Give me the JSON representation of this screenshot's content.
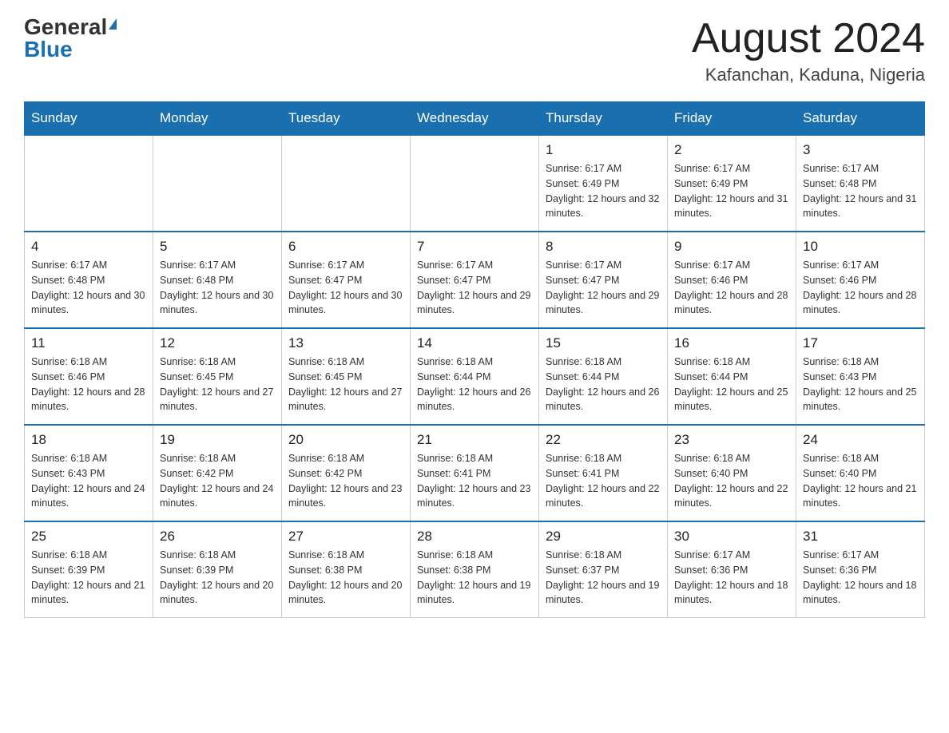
{
  "header": {
    "logo_general": "General",
    "logo_blue": "Blue",
    "month_title": "August 2024",
    "location": "Kafanchan, Kaduna, Nigeria"
  },
  "weekdays": [
    "Sunday",
    "Monday",
    "Tuesday",
    "Wednesday",
    "Thursday",
    "Friday",
    "Saturday"
  ],
  "weeks": [
    [
      {
        "day": "",
        "sunrise": "",
        "sunset": "",
        "daylight": ""
      },
      {
        "day": "",
        "sunrise": "",
        "sunset": "",
        "daylight": ""
      },
      {
        "day": "",
        "sunrise": "",
        "sunset": "",
        "daylight": ""
      },
      {
        "day": "",
        "sunrise": "",
        "sunset": "",
        "daylight": ""
      },
      {
        "day": "1",
        "sunrise": "Sunrise: 6:17 AM",
        "sunset": "Sunset: 6:49 PM",
        "daylight": "Daylight: 12 hours and 32 minutes."
      },
      {
        "day": "2",
        "sunrise": "Sunrise: 6:17 AM",
        "sunset": "Sunset: 6:49 PM",
        "daylight": "Daylight: 12 hours and 31 minutes."
      },
      {
        "day": "3",
        "sunrise": "Sunrise: 6:17 AM",
        "sunset": "Sunset: 6:48 PM",
        "daylight": "Daylight: 12 hours and 31 minutes."
      }
    ],
    [
      {
        "day": "4",
        "sunrise": "Sunrise: 6:17 AM",
        "sunset": "Sunset: 6:48 PM",
        "daylight": "Daylight: 12 hours and 30 minutes."
      },
      {
        "day": "5",
        "sunrise": "Sunrise: 6:17 AM",
        "sunset": "Sunset: 6:48 PM",
        "daylight": "Daylight: 12 hours and 30 minutes."
      },
      {
        "day": "6",
        "sunrise": "Sunrise: 6:17 AM",
        "sunset": "Sunset: 6:47 PM",
        "daylight": "Daylight: 12 hours and 30 minutes."
      },
      {
        "day": "7",
        "sunrise": "Sunrise: 6:17 AM",
        "sunset": "Sunset: 6:47 PM",
        "daylight": "Daylight: 12 hours and 29 minutes."
      },
      {
        "day": "8",
        "sunrise": "Sunrise: 6:17 AM",
        "sunset": "Sunset: 6:47 PM",
        "daylight": "Daylight: 12 hours and 29 minutes."
      },
      {
        "day": "9",
        "sunrise": "Sunrise: 6:17 AM",
        "sunset": "Sunset: 6:46 PM",
        "daylight": "Daylight: 12 hours and 28 minutes."
      },
      {
        "day": "10",
        "sunrise": "Sunrise: 6:17 AM",
        "sunset": "Sunset: 6:46 PM",
        "daylight": "Daylight: 12 hours and 28 minutes."
      }
    ],
    [
      {
        "day": "11",
        "sunrise": "Sunrise: 6:18 AM",
        "sunset": "Sunset: 6:46 PM",
        "daylight": "Daylight: 12 hours and 28 minutes."
      },
      {
        "day": "12",
        "sunrise": "Sunrise: 6:18 AM",
        "sunset": "Sunset: 6:45 PM",
        "daylight": "Daylight: 12 hours and 27 minutes."
      },
      {
        "day": "13",
        "sunrise": "Sunrise: 6:18 AM",
        "sunset": "Sunset: 6:45 PM",
        "daylight": "Daylight: 12 hours and 27 minutes."
      },
      {
        "day": "14",
        "sunrise": "Sunrise: 6:18 AM",
        "sunset": "Sunset: 6:44 PM",
        "daylight": "Daylight: 12 hours and 26 minutes."
      },
      {
        "day": "15",
        "sunrise": "Sunrise: 6:18 AM",
        "sunset": "Sunset: 6:44 PM",
        "daylight": "Daylight: 12 hours and 26 minutes."
      },
      {
        "day": "16",
        "sunrise": "Sunrise: 6:18 AM",
        "sunset": "Sunset: 6:44 PM",
        "daylight": "Daylight: 12 hours and 25 minutes."
      },
      {
        "day": "17",
        "sunrise": "Sunrise: 6:18 AM",
        "sunset": "Sunset: 6:43 PM",
        "daylight": "Daylight: 12 hours and 25 minutes."
      }
    ],
    [
      {
        "day": "18",
        "sunrise": "Sunrise: 6:18 AM",
        "sunset": "Sunset: 6:43 PM",
        "daylight": "Daylight: 12 hours and 24 minutes."
      },
      {
        "day": "19",
        "sunrise": "Sunrise: 6:18 AM",
        "sunset": "Sunset: 6:42 PM",
        "daylight": "Daylight: 12 hours and 24 minutes."
      },
      {
        "day": "20",
        "sunrise": "Sunrise: 6:18 AM",
        "sunset": "Sunset: 6:42 PM",
        "daylight": "Daylight: 12 hours and 23 minutes."
      },
      {
        "day": "21",
        "sunrise": "Sunrise: 6:18 AM",
        "sunset": "Sunset: 6:41 PM",
        "daylight": "Daylight: 12 hours and 23 minutes."
      },
      {
        "day": "22",
        "sunrise": "Sunrise: 6:18 AM",
        "sunset": "Sunset: 6:41 PM",
        "daylight": "Daylight: 12 hours and 22 minutes."
      },
      {
        "day": "23",
        "sunrise": "Sunrise: 6:18 AM",
        "sunset": "Sunset: 6:40 PM",
        "daylight": "Daylight: 12 hours and 22 minutes."
      },
      {
        "day": "24",
        "sunrise": "Sunrise: 6:18 AM",
        "sunset": "Sunset: 6:40 PM",
        "daylight": "Daylight: 12 hours and 21 minutes."
      }
    ],
    [
      {
        "day": "25",
        "sunrise": "Sunrise: 6:18 AM",
        "sunset": "Sunset: 6:39 PM",
        "daylight": "Daylight: 12 hours and 21 minutes."
      },
      {
        "day": "26",
        "sunrise": "Sunrise: 6:18 AM",
        "sunset": "Sunset: 6:39 PM",
        "daylight": "Daylight: 12 hours and 20 minutes."
      },
      {
        "day": "27",
        "sunrise": "Sunrise: 6:18 AM",
        "sunset": "Sunset: 6:38 PM",
        "daylight": "Daylight: 12 hours and 20 minutes."
      },
      {
        "day": "28",
        "sunrise": "Sunrise: 6:18 AM",
        "sunset": "Sunset: 6:38 PM",
        "daylight": "Daylight: 12 hours and 19 minutes."
      },
      {
        "day": "29",
        "sunrise": "Sunrise: 6:18 AM",
        "sunset": "Sunset: 6:37 PM",
        "daylight": "Daylight: 12 hours and 19 minutes."
      },
      {
        "day": "30",
        "sunrise": "Sunrise: 6:17 AM",
        "sunset": "Sunset: 6:36 PM",
        "daylight": "Daylight: 12 hours and 18 minutes."
      },
      {
        "day": "31",
        "sunrise": "Sunrise: 6:17 AM",
        "sunset": "Sunset: 6:36 PM",
        "daylight": "Daylight: 12 hours and 18 minutes."
      }
    ]
  ]
}
